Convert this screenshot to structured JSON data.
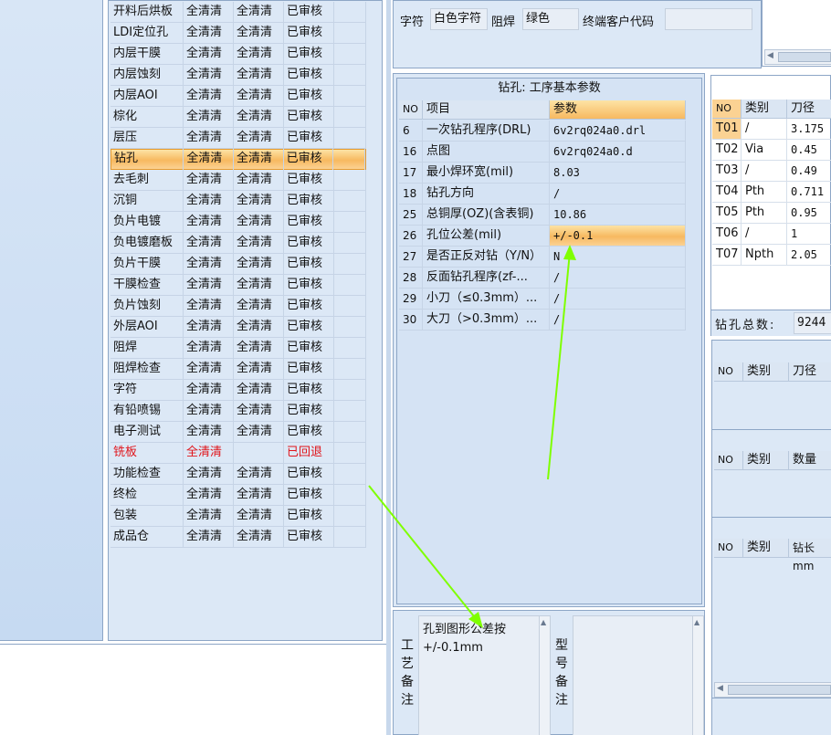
{
  "process_list": [
    {
      "name": "开料后烘板",
      "a": "全清清",
      "b": "全清清",
      "status": "已审核"
    },
    {
      "name": "LDI定位孔",
      "a": "全清清",
      "b": "全清清",
      "status": "已审核"
    },
    {
      "name": "内层干膜",
      "a": "全清清",
      "b": "全清清",
      "status": "已审核"
    },
    {
      "name": "内层蚀刻",
      "a": "全清清",
      "b": "全清清",
      "status": "已审核"
    },
    {
      "name": "内层AOI",
      "a": "全清清",
      "b": "全清清",
      "status": "已审核"
    },
    {
      "name": "棕化",
      "a": "全清清",
      "b": "全清清",
      "status": "已审核"
    },
    {
      "name": "层压",
      "a": "全清清",
      "b": "全清清",
      "status": "已审核"
    },
    {
      "name": "钻孔",
      "a": "全清清",
      "b": "全清清",
      "status": "已审核"
    },
    {
      "name": "去毛刺",
      "a": "全清清",
      "b": "全清清",
      "status": "已审核"
    },
    {
      "name": "沉铜",
      "a": "全清清",
      "b": "全清清",
      "status": "已审核"
    },
    {
      "name": "负片电镀",
      "a": "全清清",
      "b": "全清清",
      "status": "已审核"
    },
    {
      "name": "负电镀磨板",
      "a": "全清清",
      "b": "全清清",
      "status": "已审核"
    },
    {
      "name": "负片干膜",
      "a": "全清清",
      "b": "全清清",
      "status": "已审核"
    },
    {
      "name": "干膜检查",
      "a": "全清清",
      "b": "全清清",
      "status": "已审核"
    },
    {
      "name": "负片蚀刻",
      "a": "全清清",
      "b": "全清清",
      "status": "已审核"
    },
    {
      "name": "外层AOI",
      "a": "全清清",
      "b": "全清清",
      "status": "已审核"
    },
    {
      "name": "阻焊",
      "a": "全清清",
      "b": "全清清",
      "status": "已审核"
    },
    {
      "name": "阻焊检查",
      "a": "全清清",
      "b": "全清清",
      "status": "已审核"
    },
    {
      "name": "字符",
      "a": "全清清",
      "b": "全清清",
      "status": "已审核"
    },
    {
      "name": "有铅喷锡",
      "a": "全清清",
      "b": "全清清",
      "status": "已审核"
    },
    {
      "name": "电子测试",
      "a": "全清清",
      "b": "全清清",
      "status": "已审核"
    },
    {
      "name": "铣板",
      "a": "全清清",
      "b": "",
      "status": "已回退"
    },
    {
      "name": "功能检查",
      "a": "全清清",
      "b": "全清清",
      "status": "已审核"
    },
    {
      "name": "终检",
      "a": "全清清",
      "b": "全清清",
      "status": "已审核"
    },
    {
      "name": "包装",
      "a": "全清清",
      "b": "全清清",
      "status": "已审核"
    },
    {
      "name": "成品仓",
      "a": "全清清",
      "b": "全清清",
      "status": "已审核"
    }
  ],
  "top_info": {
    "char_label": "字符",
    "char_value": "白色字符",
    "mask_label": "阻焊",
    "mask_value": "绿色",
    "customer_code_label": "终端客户代码",
    "customer_code_value": ""
  },
  "drill_params": {
    "title": "钻孔: 工序基本参数",
    "headers": {
      "no": "NO",
      "item": "项目",
      "param": "参数"
    },
    "rows": [
      {
        "no": "6",
        "item": "一次钻孔程序(DRL)",
        "param": "6v2rq024a0.drl"
      },
      {
        "no": "16",
        "item": "点图",
        "param": "6v2rq024a0.d"
      },
      {
        "no": "17",
        "item": "最小焊环宽(mil)",
        "param": "8.03"
      },
      {
        "no": "18",
        "item": "钻孔方向",
        "param": "/"
      },
      {
        "no": "25",
        "item": "总铜厚(OZ)(含表铜)",
        "param": "10.86"
      },
      {
        "no": "26",
        "item": "孔位公差(mil)",
        "param": "+/-0.1"
      },
      {
        "no": "27",
        "item": "是否正反对钻（Y/N）",
        "param": "N"
      },
      {
        "no": "28",
        "item": "反面钻孔程序(zf-...",
        "param": "/"
      },
      {
        "no": "29",
        "item": "小刀（≤0.3mm）...",
        "param": "/"
      },
      {
        "no": "30",
        "item": "大刀（>0.3mm）...",
        "param": "/"
      }
    ]
  },
  "tools": {
    "headers": {
      "no": "NO",
      "type": "类别",
      "dia": "刀径"
    },
    "rows": [
      {
        "no": "T01",
        "type": "/",
        "dia": "3.175"
      },
      {
        "no": "T02",
        "type": "Via",
        "dia": "0.45"
      },
      {
        "no": "T03",
        "type": "/",
        "dia": "0.49"
      },
      {
        "no": "T04",
        "type": "Pth",
        "dia": "0.711"
      },
      {
        "no": "T05",
        "type": "Pth",
        "dia": "0.95"
      },
      {
        "no": "T06",
        "type": "/",
        "dia": "1"
      },
      {
        "no": "T07",
        "type": "Npth",
        "dia": "2.05"
      }
    ],
    "total_label": "钻孔总数:",
    "total_value": "9244"
  },
  "sub_tables": [
    {
      "no": "NO",
      "type": "类别",
      "col": "刀径"
    },
    {
      "no": "NO",
      "type": "类别",
      "col": "数量"
    },
    {
      "no": "NO",
      "type": "类别",
      "col": "钻长mm"
    }
  ],
  "remarks": {
    "process_label": "工艺备注",
    "process_text_line1": "孔到图形公差按",
    "process_text_line2": "+/-0.1mm",
    "model_label": "型号备注",
    "model_text": ""
  },
  "colors": {
    "accent_green": "#7fff00",
    "selection_orange": "#f7b960",
    "panel_blue": "#dce8f6",
    "alert_red": "#e0141a"
  }
}
